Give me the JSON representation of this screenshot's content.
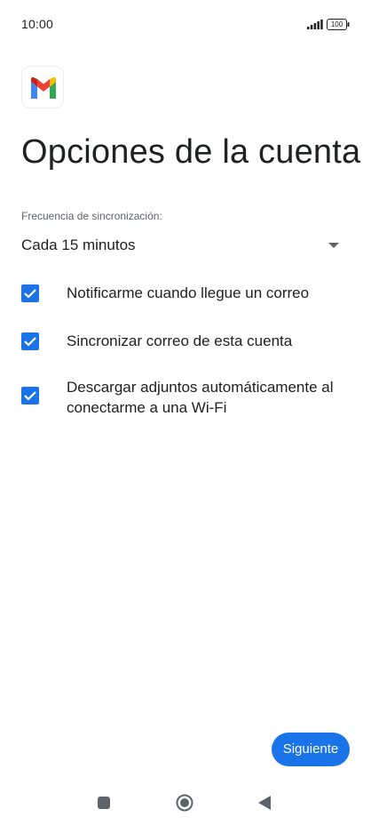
{
  "status_bar": {
    "time": "10:00",
    "signal_icon": "signal-bars-icon",
    "battery_level": "100",
    "battery_icon": "battery-icon"
  },
  "app": {
    "logo_icon": "gmail-logo-icon"
  },
  "page": {
    "title": "Opciones de la cuenta"
  },
  "sync": {
    "label": "Frecuencia de sincronización:",
    "value": "Cada 15 minutos",
    "dropdown_icon": "dropdown-arrow-icon"
  },
  "options": [
    {
      "label": "Notificarme cuando llegue un correo",
      "checked": true
    },
    {
      "label": "Sincronizar correo de esta cuenta",
      "checked": true
    },
    {
      "label": "Descargar adjuntos automáticamente al conectarme a una Wi-Fi",
      "checked": true
    }
  ],
  "actions": {
    "next_label": "Siguiente"
  },
  "nav_bar": {
    "recents_icon": "recents-square-icon",
    "home_icon": "home-circle-icon",
    "back_icon": "back-triangle-icon"
  },
  "colors": {
    "accent": "#1a73e8",
    "text_primary": "#202124",
    "text_secondary": "#5f6368"
  }
}
